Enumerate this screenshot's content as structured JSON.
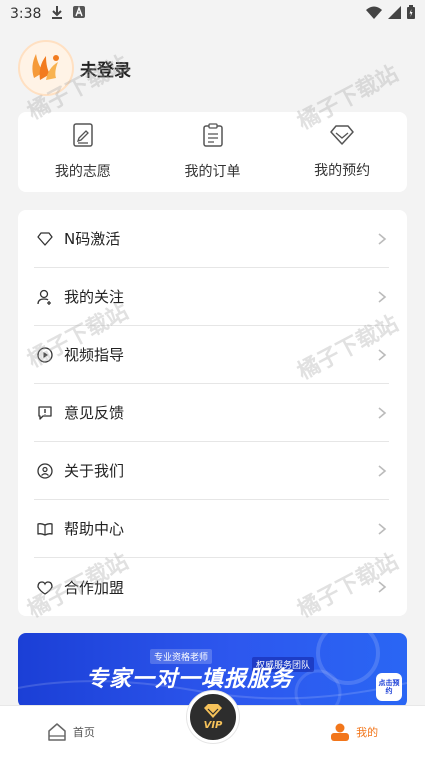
{
  "status_bar": {
    "time": "3:38"
  },
  "profile": {
    "login_label": "未登录"
  },
  "quick_actions": [
    {
      "label": "我的志愿",
      "icon": "edit-document-icon"
    },
    {
      "label": "我的订单",
      "icon": "clipboard-list-icon"
    },
    {
      "label": "我的预约",
      "icon": "diamond-icon"
    }
  ],
  "menu": [
    {
      "label": "N码激活",
      "icon": "diamond-outline-icon"
    },
    {
      "label": "我的关注",
      "icon": "user-follow-icon"
    },
    {
      "label": "视频指导",
      "icon": "video-play-icon"
    },
    {
      "label": "意见反馈",
      "icon": "feedback-icon"
    },
    {
      "label": "关于我们",
      "icon": "about-icon"
    },
    {
      "label": "帮助中心",
      "icon": "book-icon"
    },
    {
      "label": "合作加盟",
      "icon": "handshake-icon"
    }
  ],
  "banner": {
    "title": "专家一对一填报服务",
    "tag1": "专业资格老师",
    "tag2": "权威服务团队",
    "cta": "点击预约"
  },
  "tabbar": {
    "home_label": "首页",
    "vip_label": "VIP",
    "mine_label": "我的"
  },
  "watermark": "橘子下载站",
  "colors": {
    "accent": "#f2761b",
    "banner_blue": "#1b3fd6",
    "vip_gold": "#f6c25a"
  }
}
